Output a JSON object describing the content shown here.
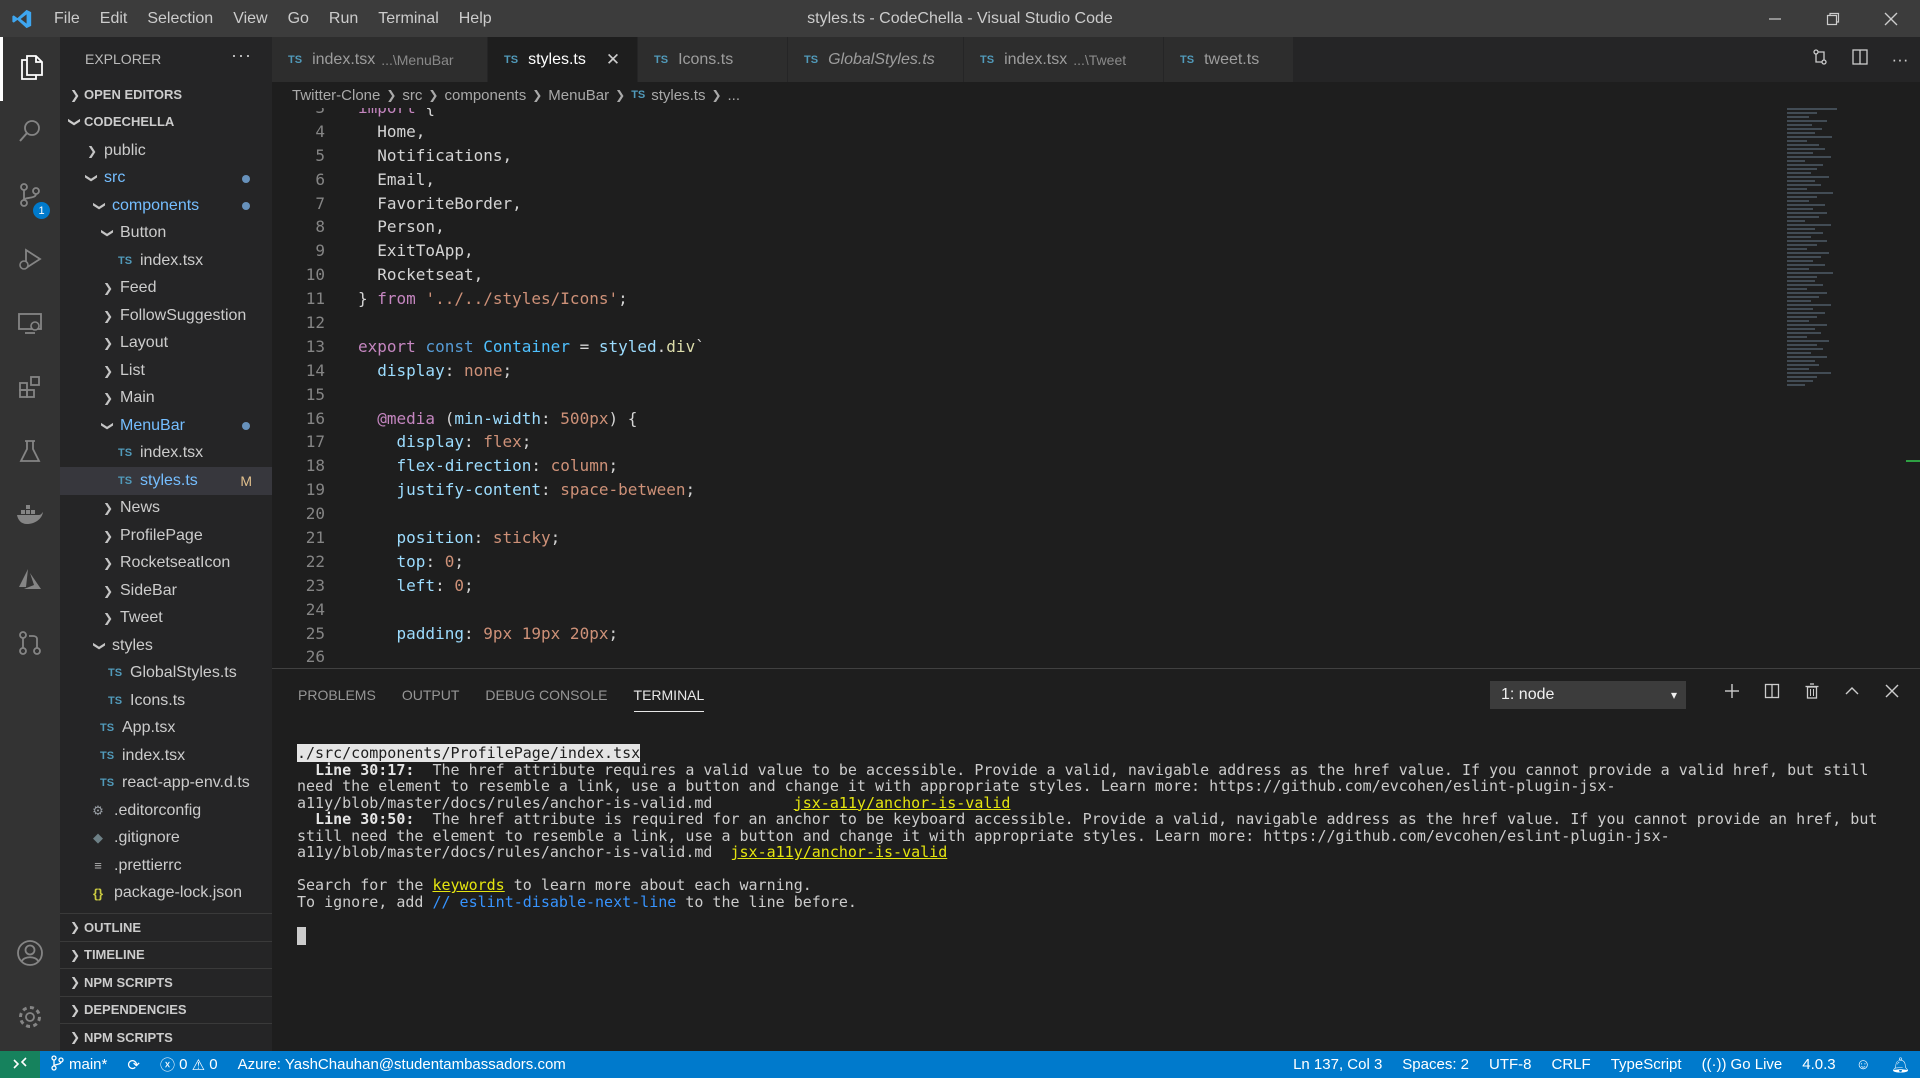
{
  "window": {
    "title": "styles.ts - CodeChella - Visual Studio Code",
    "menu": [
      "File",
      "Edit",
      "Selection",
      "View",
      "Go",
      "Run",
      "Terminal",
      "Help"
    ]
  },
  "activity": {
    "scm_badge": "1"
  },
  "sidebar": {
    "header": "EXPLORER",
    "sections": {
      "open_editors": "OPEN EDITORS",
      "root": "CODECHELLA"
    },
    "tree": [
      {
        "label": "public",
        "type": "folder-closed"
      },
      {
        "label": "src",
        "type": "folder-open"
      },
      {
        "label": "components",
        "type": "folder-open"
      },
      {
        "label": "Button",
        "type": "folder-open"
      },
      {
        "label": "index.tsx",
        "type": "ts"
      },
      {
        "label": "Feed",
        "type": "folder-closed"
      },
      {
        "label": "FollowSuggestion",
        "type": "folder-closed"
      },
      {
        "label": "Layout",
        "type": "folder-closed"
      },
      {
        "label": "List",
        "type": "folder-closed"
      },
      {
        "label": "Main",
        "type": "folder-closed"
      },
      {
        "label": "MenuBar",
        "type": "folder-open"
      },
      {
        "label": "index.tsx",
        "type": "ts"
      },
      {
        "label": "styles.ts",
        "type": "ts",
        "badge": "M"
      },
      {
        "label": "News",
        "type": "folder-closed"
      },
      {
        "label": "ProfilePage",
        "type": "folder-closed"
      },
      {
        "label": "RocketseatIcon",
        "type": "folder-closed"
      },
      {
        "label": "SideBar",
        "type": "folder-closed"
      },
      {
        "label": "Tweet",
        "type": "folder-closed"
      },
      {
        "label": "styles",
        "type": "folder-open"
      },
      {
        "label": "GlobalStyles.ts",
        "type": "ts"
      },
      {
        "label": "Icons.ts",
        "type": "ts"
      },
      {
        "label": "App.tsx",
        "type": "ts"
      },
      {
        "label": "index.tsx",
        "type": "ts"
      },
      {
        "label": "react-app-env.d.ts",
        "type": "ts"
      },
      {
        "label": ".editorconfig",
        "type": "gear"
      },
      {
        "label": ".gitignore",
        "type": "diamond"
      },
      {
        "label": ".prettierrc",
        "type": "lines"
      },
      {
        "label": "package-lock.json",
        "type": "json"
      }
    ],
    "bottom_sections": [
      "OUTLINE",
      "TIMELINE",
      "NPM SCRIPTS",
      "DEPENDENCIES",
      "NPM SCRIPTS"
    ]
  },
  "tabs": [
    {
      "label": "index.tsx",
      "desc": "...\\MenuBar"
    },
    {
      "label": "styles.ts",
      "desc": ""
    },
    {
      "label": "Icons.ts",
      "desc": ""
    },
    {
      "label": "GlobalStyles.ts",
      "desc": ""
    },
    {
      "label": "index.tsx",
      "desc": "...\\Tweet"
    },
    {
      "label": "tweet.ts",
      "desc": ""
    }
  ],
  "tab_prefix": "TS",
  "breadcrumb": [
    "Twitter-Clone",
    "src",
    "components",
    "MenuBar",
    "styles.ts",
    "..."
  ],
  "panel": {
    "tabs": [
      "PROBLEMS",
      "OUTPUT",
      "DEBUG CONSOLE",
      "TERMINAL"
    ],
    "terminal_select": "1: node",
    "terminal": {
      "path": "./src/components/ProfilePage/index.tsx",
      "w1_loc": "Line 30:17:",
      "w1_text": "  The href attribute requires a valid value to be accessible. Provide a valid, navigable address as the href value. If you cannot provide a valid href, but still need the element to resemble a link, use a button and change it with appropriate styles. Learn more: https://github.com/evcohen/eslint-plugin-jsx-a11y/blob/master/docs/rules/anchor-is-valid.md         ",
      "w1_rule": "jsx-a11y/anchor-is-valid",
      "w2_loc": "Line 30:50:",
      "w2_text": "  The href attribute is required for an anchor to be keyboard accessible. Provide a valid, navigable address as the href value. If you cannot provide an href, but still need the element to resemble a link, use a button and change it with appropriate styles. Learn more: https://github.com/evcohen/eslint-plugin-jsx-a11y/blob/master/docs/rules/anchor-is-valid.md  ",
      "w2_rule": "jsx-a11y/anchor-is-valid",
      "search_pre": "Search for the ",
      "search_kw": "keywords",
      "search_post": " to learn more about each warning.",
      "ignore_pre": "To ignore, add ",
      "ignore_cmt": "// eslint-disable-next-line",
      "ignore_post": " to the line before."
    }
  },
  "status": {
    "branch": "main*",
    "errors": "0",
    "warnings": "0",
    "azure": "Azure: YashChauhan@studentambassadors.com",
    "position": "Ln 137, Col 3",
    "spaces": "Spaces: 2",
    "encoding": "UTF-8",
    "eol": "CRLF",
    "language": "TypeScript",
    "golive": "Go Live",
    "version": "4.0.3"
  },
  "colors": {
    "statusbar": "#007acc",
    "remote": "#16825d",
    "activitybar": "#333333",
    "sidebar": "#252526",
    "editor": "#1e1e1e"
  }
}
